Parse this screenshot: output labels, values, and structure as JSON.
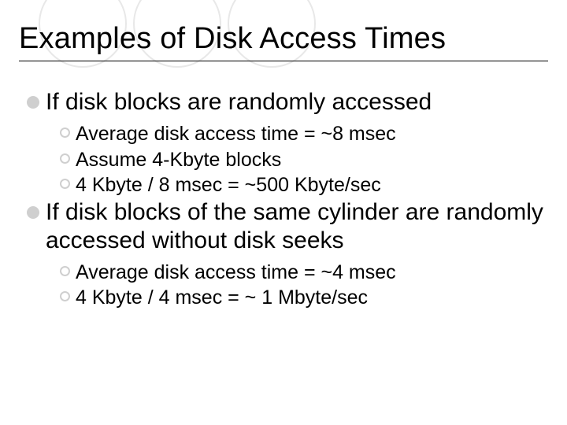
{
  "title": "Examples of Disk Access Times",
  "points": [
    {
      "text": "If disk blocks are randomly accessed",
      "sub": [
        "Average disk access time = ~8 msec",
        "Assume 4-Kbyte blocks",
        "4 Kbyte / 8 msec = ~500 Kbyte/sec"
      ]
    },
    {
      "text": "If disk blocks of the same cylinder are randomly accessed without disk seeks",
      "sub": [
        "Average disk access time = ~4 msec",
        "4 Kbyte / 4 msec = ~ 1 Mbyte/sec"
      ]
    }
  ],
  "circle_color": "#e8e8e8"
}
